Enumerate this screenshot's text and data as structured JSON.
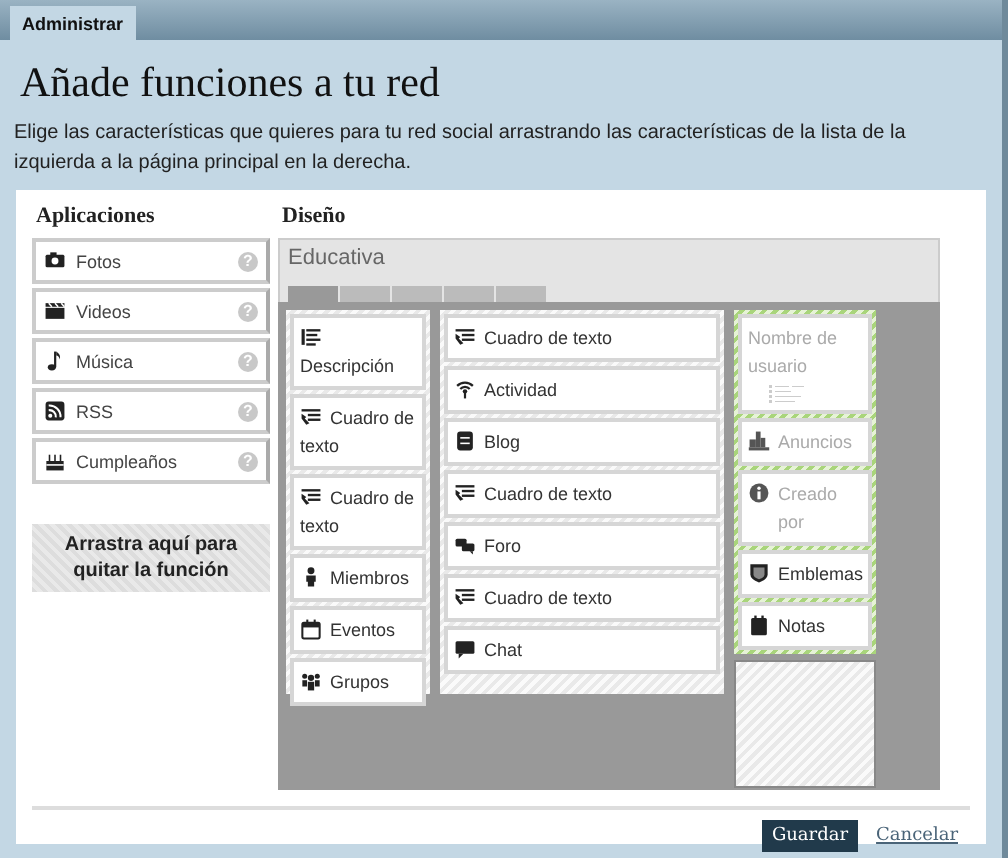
{
  "top_tab": {
    "label": "Administrar",
    "selected": true
  },
  "title": "Añade funciones a tu red",
  "description": "Elige las características que quieres para tu red social arrastrando las características de la lista de la izquierda a la página principal en la derecha.",
  "applications": {
    "heading": "Aplicaciones",
    "items": [
      {
        "label": "Fotos",
        "help": "?"
      },
      {
        "label": "Videos",
        "help": "?"
      },
      {
        "label": "Música",
        "help": "?"
      },
      {
        "label": "RSS",
        "help": "?"
      },
      {
        "label": "Cumpleaños",
        "help": "?"
      }
    ],
    "drop_zone": "Arrastra aquí para quitar la función"
  },
  "design": {
    "heading": "Diseño",
    "theme_name": "Educativa",
    "layout_tabs": [
      {
        "selected": true
      },
      {
        "selected": false
      },
      {
        "selected": false
      },
      {
        "selected": false
      },
      {
        "selected": false
      }
    ],
    "columns": [
      {
        "locked": false,
        "items": [
          {
            "label": "Descripción",
            "disabled": false
          },
          {
            "label": "Cuadro de texto",
            "disabled": false
          },
          {
            "label": "Cuadro de texto",
            "disabled": false
          },
          {
            "label": "Miembros",
            "disabled": false
          },
          {
            "label": "Eventos",
            "disabled": false
          },
          {
            "label": "Grupos",
            "disabled": false
          }
        ]
      },
      {
        "locked": false,
        "items": [
          {
            "label": "Cuadro de texto",
            "disabled": false
          },
          {
            "label": "Actividad",
            "disabled": false
          },
          {
            "label": "Blog",
            "disabled": false
          },
          {
            "label": "Cuadro de texto",
            "disabled": false
          },
          {
            "label": "Foro",
            "disabled": false
          },
          {
            "label": "Cuadro de texto",
            "disabled": false
          },
          {
            "label": "Chat",
            "disabled": false
          }
        ]
      },
      {
        "locked": true,
        "items": [
          {
            "label": "Nombre de usuario",
            "disabled": true,
            "kind": "profile"
          },
          {
            "label": "Anuncios",
            "disabled": true,
            "kind": "module"
          },
          {
            "label": "Creado por",
            "disabled": true,
            "kind": "module"
          },
          {
            "label": "Emblemas",
            "disabled": false,
            "kind": "module"
          },
          {
            "label": "Notas",
            "disabled": false,
            "kind": "module"
          }
        ]
      }
    ]
  },
  "buttons": {
    "save": "Guardar",
    "cancel": "Cancelar"
  }
}
